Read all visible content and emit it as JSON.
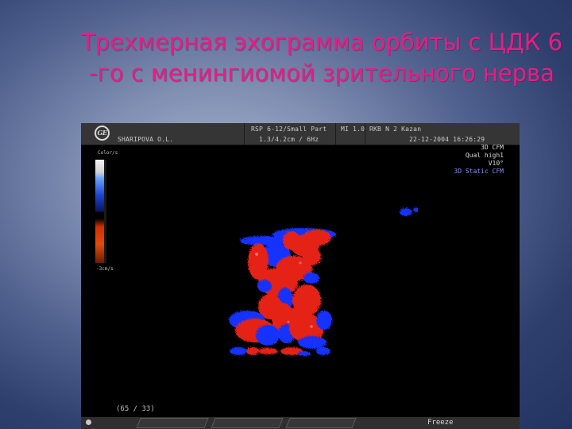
{
  "slide": {
    "title_line1": "Трехмерная эхограмма орбиты с ЦДК 6",
    "title_line2": "-го с менингиомой зрительного нерва",
    "title_color": "#ea1b86"
  },
  "scanner_header": {
    "logo": "GE",
    "patient_name": "SHARIPOVA O.L.",
    "probe": "RSP 6-12/Small Part",
    "depth_freq": "1.3/4.2cm / 6Hz",
    "mi": "MI  1.0",
    "facility": "RKB N 2 Kazan",
    "date_time": "22-12-2004  16:26:29"
  },
  "scan_info": {
    "line1": "3D CFM",
    "line2": "Qual high1",
    "line3": "V10°",
    "line4": "3D Static CFM",
    "line4_color": "#8c8cff"
  },
  "color_scale": {
    "top_label": "Color/s",
    "bottom_label": "-3cm/s",
    "colors": [
      "#f2f2f2",
      "#1e46d5",
      "#000000",
      "#d03000",
      "#6b1d00"
    ]
  },
  "image": {
    "description_icon": "doppler-ultrasound-image",
    "flow_colors": [
      "#e52413",
      "#1732ff"
    ]
  },
  "footer": {
    "frame_counter": "(65 / 33)",
    "freeze": "Freeze"
  }
}
